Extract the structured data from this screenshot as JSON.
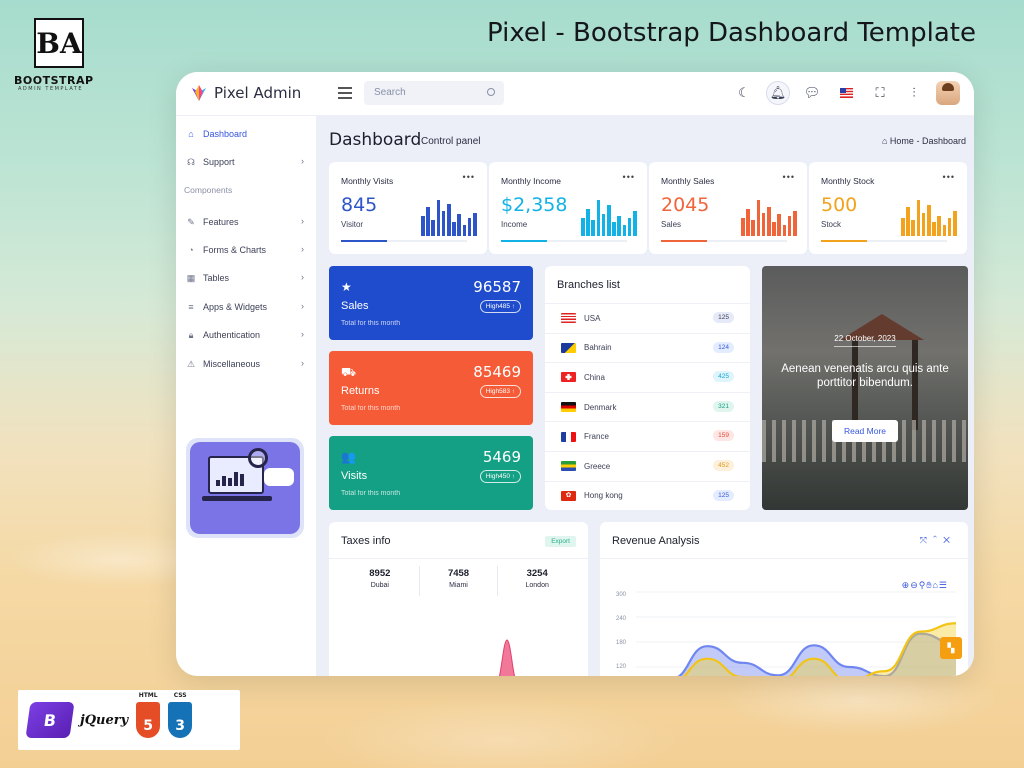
{
  "promo": {
    "logo_letters": "BA",
    "brand": "BOOTSTRAP",
    "brand_sub": "ADMIN TEMPLATE",
    "title": "Pixel - Bootstrap Dashboard Template",
    "tech": [
      "jQuery",
      "HTML",
      "5",
      "CSS",
      "3"
    ]
  },
  "topbar": {
    "app_name": "Pixel Admin",
    "search_placeholder": "Search",
    "icons": [
      "moon-icon",
      "bell-icon",
      "chat-icon",
      "flag-us-icon",
      "fullscreen-icon",
      "settings-sliders-icon",
      "avatar"
    ]
  },
  "sidebar": {
    "items": [
      {
        "label": "Dashboard",
        "icon": "home-icon",
        "active": true
      },
      {
        "label": "Support",
        "icon": "headset-icon",
        "chevron": true
      },
      {
        "label": "Features",
        "icon": "edit-icon",
        "chevron": true
      },
      {
        "label": "Forms & Charts",
        "icon": "pie-icon",
        "chevron": true
      },
      {
        "label": "Tables",
        "icon": "grid-icon",
        "chevron": true
      },
      {
        "label": "Apps & Widgets",
        "icon": "database-icon",
        "chevron": true
      },
      {
        "label": "Authentication",
        "icon": "lock-icon",
        "chevron": true
      },
      {
        "label": "Miscellaneous",
        "icon": "warning-icon",
        "chevron": true
      }
    ],
    "section_label": "Components"
  },
  "page": {
    "title": "Dashboard",
    "subtitle": "Control panel",
    "breadcrumb_home": "Home",
    "breadcrumb_sep": "-",
    "breadcrumb_current": "Dashboard"
  },
  "stats": [
    {
      "label": "Monthly Visits",
      "value": "845",
      "sub": "Visitor",
      "color": "#2d55c9",
      "bars": [
        0.55,
        0.8,
        0.45,
        1.0,
        0.7,
        0.9,
        0.4,
        0.6,
        0.3,
        0.5,
        0.65
      ]
    },
    {
      "label": "Monthly Income",
      "value": "$2,358",
      "sub": "Income",
      "color": "#12b2e6",
      "bars": [
        0.5,
        0.75,
        0.45,
        1.0,
        0.6,
        0.85,
        0.4,
        0.55,
        0.3,
        0.5,
        0.7
      ]
    },
    {
      "label": "Monthly Sales",
      "value": "2045",
      "sub": "Sales",
      "color": "#f0643a",
      "bars": [
        0.5,
        0.75,
        0.45,
        1.0,
        0.65,
        0.8,
        0.4,
        0.6,
        0.3,
        0.55,
        0.7
      ]
    },
    {
      "label": "Monthly Stock",
      "value": "500",
      "sub": "Stock",
      "color": "#f2a21c",
      "bars": [
        0.5,
        0.8,
        0.45,
        1.0,
        0.65,
        0.85,
        0.4,
        0.55,
        0.3,
        0.5,
        0.7
      ]
    }
  ],
  "kpis": [
    {
      "label": "Sales",
      "sub": "Total for this month",
      "value": "96587",
      "pill": "High485 ↑",
      "color": "#1f4ccc",
      "icon": "★"
    },
    {
      "label": "Returns",
      "sub": "Total for this month",
      "value": "85469",
      "pill": "High583 ↑",
      "color": "#f65b37",
      "icon": "⛟"
    },
    {
      "label": "Visits",
      "sub": "Total for this month",
      "value": "5469",
      "pill": "High450 ↑",
      "color": "#14a085",
      "icon": "👥"
    }
  ],
  "branches": {
    "title": "Branches list",
    "rows": [
      {
        "country": "USA",
        "count": "125",
        "badge_bg": "#e6e9f8",
        "badge_fg": "#3b3f55",
        "flag": "us"
      },
      {
        "country": "Bahrain",
        "count": "124",
        "badge_bg": "#e3edff",
        "badge_fg": "#3656e0",
        "flag": "ba"
      },
      {
        "country": "China",
        "count": "425",
        "badge_bg": "#dff4fb",
        "badge_fg": "#12a8d6",
        "flag": "ch"
      },
      {
        "country": "Denmark",
        "count": "321",
        "badge_bg": "#dff5ee",
        "badge_fg": "#14a085",
        "flag": "de"
      },
      {
        "country": "France",
        "count": "159",
        "badge_bg": "#fde6e3",
        "badge_fg": "#e34b3a",
        "flag": "fr"
      },
      {
        "country": "Greece",
        "count": "452",
        "badge_bg": "#fdf0dc",
        "badge_fg": "#e09a16",
        "flag": "gr"
      },
      {
        "country": "Hong kong",
        "count": "125",
        "badge_bg": "#e3edff",
        "badge_fg": "#3656e0",
        "flag": "hk"
      }
    ]
  },
  "photo_card": {
    "date": "22 October, 2023",
    "caption": "Aenean venenatis arcu quis ante porttitor bibendum.",
    "button": "Read More"
  },
  "taxes": {
    "title": "Taxes info",
    "export": "Export",
    "stats": [
      {
        "value": "8952",
        "city": "Dubai"
      },
      {
        "value": "7458",
        "city": "Miami"
      },
      {
        "value": "3254",
        "city": "London"
      }
    ]
  },
  "revenue": {
    "title": "Revenue Analysis",
    "y_ticks": [
      "300",
      "240",
      "180",
      "120"
    ]
  },
  "chart_data": {
    "type": "area",
    "y_ticks": [
      300,
      240,
      180,
      120
    ],
    "ylim": [
      60,
      300
    ],
    "series": [
      {
        "values": [
          90,
          92,
          170,
          130,
          100,
          172,
          120,
          98,
          200,
          175
        ]
      },
      {
        "values": [
          80,
          84,
          140,
          96,
          86,
          140,
          86,
          110,
          205,
          225
        ]
      }
    ]
  }
}
